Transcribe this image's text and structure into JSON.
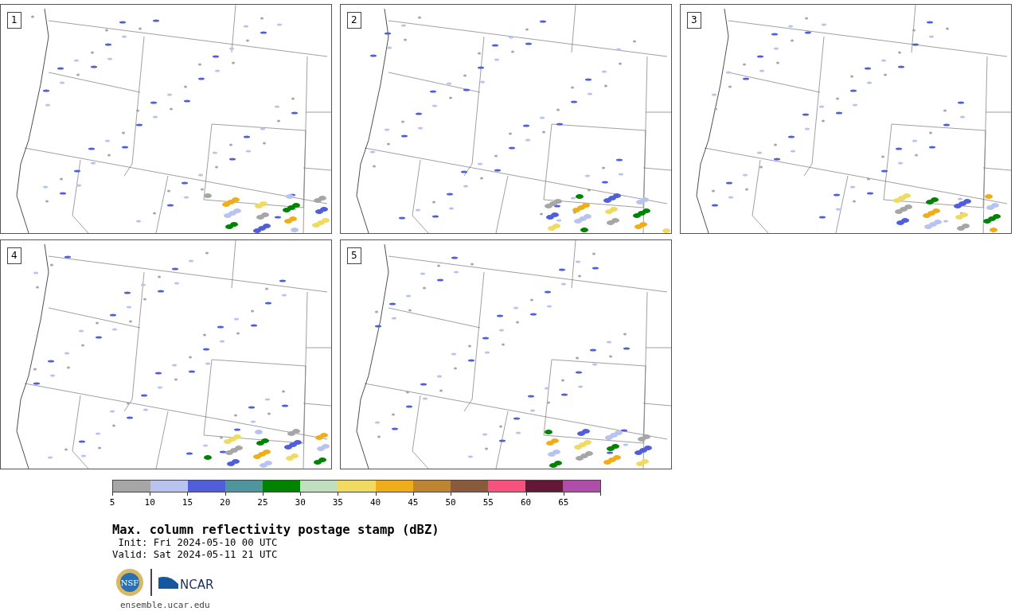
{
  "panels": [
    {
      "label": "1"
    },
    {
      "label": "2"
    },
    {
      "label": "3"
    },
    {
      "label": "4"
    },
    {
      "label": "5"
    }
  ],
  "colorbar": {
    "bins": [
      {
        "label": "5",
        "color": "#a6a6a6"
      },
      {
        "label": "10",
        "color": "#b8c3ef"
      },
      {
        "label": "15",
        "color": "#505fd9"
      },
      {
        "label": "20",
        "color": "#4f959e"
      },
      {
        "label": "25",
        "color": "#008400"
      },
      {
        "label": "30",
        "color": "#bfdfbf"
      },
      {
        "label": "35",
        "color": "#f0da60"
      },
      {
        "label": "40",
        "color": "#f0ad1a"
      },
      {
        "label": "45",
        "color": "#bd8431"
      },
      {
        "label": "50",
        "color": "#8b5a3c"
      },
      {
        "label": "55",
        "color": "#f5527d"
      },
      {
        "label": "60",
        "color": "#621836"
      },
      {
        "label": "65",
        "color": "#ae4ea8"
      }
    ]
  },
  "title": "Max. column reflectivity postage stamp (dBZ)",
  "init": " Init: Fri 2024-05-10 00 UTC",
  "valid": "Valid: Sat 2024-05-11 21 UTC",
  "logos": {
    "seal_text": "NSF",
    "wordmark": "NCAR"
  },
  "url": "ensemble.ucar.edu"
}
